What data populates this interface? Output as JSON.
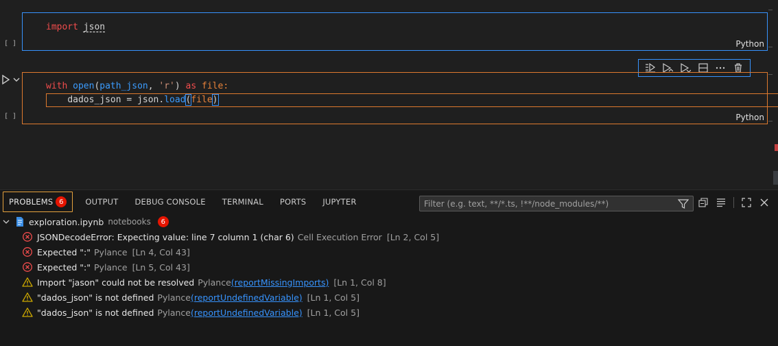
{
  "cells": [
    {
      "exec": "[ ]",
      "language": "Python",
      "lines": [
        [
          "import ",
          "json"
        ]
      ]
    },
    {
      "exec": "[ ]",
      "language": "Python",
      "line1": {
        "kw_with": "with",
        "fn_open": "open",
        "p1": "(",
        "arg": "path_json",
        "comma": ", ",
        "mode": "'r'",
        "p2": ")",
        "kw_as": " as ",
        "var": "file",
        "colon": ":"
      },
      "line2": {
        "indent": "    ",
        "lhs": "dados_json",
        "eq": " = ",
        "mod": "json",
        "dot": ".",
        "fn": "load",
        "p1": "(",
        "arg": "file",
        "p2": ")"
      }
    }
  ],
  "panel": {
    "tabs": [
      {
        "label": "PROBLEMS",
        "badge": "6"
      },
      {
        "label": "OUTPUT"
      },
      {
        "label": "DEBUG CONSOLE"
      },
      {
        "label": "TERMINAL"
      },
      {
        "label": "PORTS"
      },
      {
        "label": "JUPYTER"
      }
    ],
    "filter_placeholder": "Filter (e.g. text, **/*.ts, !**/node_modules/**)",
    "file": {
      "name": "exploration.ipynb",
      "dir": "notebooks",
      "count": "6"
    },
    "problems": [
      {
        "severity": "error",
        "message": "JSONDecodeError: Expecting value: line 7 column 1 (char 6)",
        "source": "Cell Execution Error",
        "code": "",
        "position": "[Ln 2, Col 5]"
      },
      {
        "severity": "error",
        "message": "Expected \":\"",
        "source": "Pylance",
        "code": "",
        "position": "[Ln 4, Col 43]"
      },
      {
        "severity": "error",
        "message": "Expected \":\"",
        "source": "Pylance",
        "code": "",
        "position": "[Ln 5, Col 43]"
      },
      {
        "severity": "warning",
        "message": "Import \"jason\" could not be resolved",
        "source": "Pylance",
        "code": "(reportMissingImports)",
        "position": "[Ln 1, Col 8]"
      },
      {
        "severity": "warning",
        "message": "\"dados_json\" is not defined",
        "source": "Pylance",
        "code": "(reportUndefinedVariable)",
        "position": "[Ln 1, Col 5]"
      },
      {
        "severity": "warning",
        "message": "\"dados_json\" is not defined",
        "source": "Pylance",
        "code": "(reportUndefinedVariable)",
        "position": "[Ln 1, Col 5]"
      }
    ]
  },
  "colors": {
    "error": "#f14c4c",
    "warning": "#cca700",
    "accent": "#3794ff",
    "focus": "#e07a2e"
  }
}
